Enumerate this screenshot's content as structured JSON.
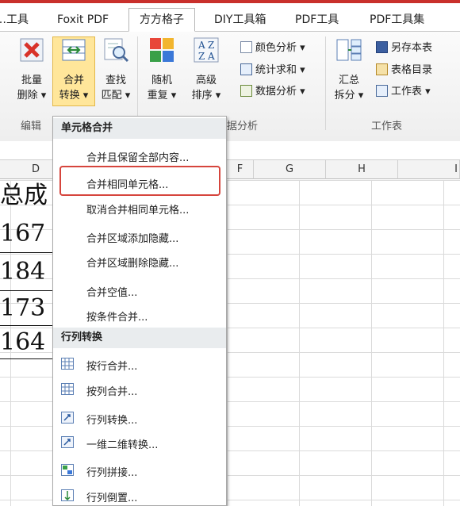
{
  "tabs": [
    "…工具",
    "Foxit PDF",
    "方方格子",
    "DIY工具箱",
    "PDF工具",
    "PDF工具集"
  ],
  "active_tab": "方方格子",
  "ribbon": {
    "group_labels": {
      "edit": "编辑",
      "analysis": "据分析",
      "worksheet": "工作表"
    },
    "buttons": {
      "batch_delete": [
        "批量",
        "删除 ▾"
      ],
      "merge_convert": [
        "合并",
        "转换 ▾"
      ],
      "find_match": [
        "查找",
        "匹配 ▾"
      ],
      "random_repeat": [
        "随机",
        "重复 ▾"
      ],
      "advanced_sort": [
        "高级",
        "排序 ▾"
      ],
      "summary_split": [
        "汇总",
        "拆分 ▾"
      ]
    },
    "small": {
      "color_analysis": "颜色分析 ▾",
      "stat_sum": "统计求和 ▾",
      "data_analysis": "数据分析 ▾",
      "save_this_sheet": "另存本表",
      "table_catalog": "表格目录",
      "worksheet_menu": "工作表 ▾"
    }
  },
  "columns": [
    "D",
    "F",
    "G",
    "H",
    "I"
  ],
  "cells": [
    "总成",
    "167",
    "184",
    "173",
    "164"
  ],
  "menu": {
    "section1": "单元格合并",
    "items1": [
      "合并且保留全部内容...",
      "合并相同单元格...",
      "取消合并相同单元格...",
      "合并区域添加隐藏...",
      "合并区域删除隐藏...",
      "合并空值...",
      "按条件合并..."
    ],
    "section2": "行列转换",
    "items2": [
      "按行合并...",
      "按列合并...",
      "行列转换...",
      "一维二维转换...",
      "行列拼接...",
      "行列倒置..."
    ]
  },
  "colors": {
    "accent_red": "#d6453d",
    "highlight": "#ffe69a",
    "top_bar": "#c9302c"
  }
}
